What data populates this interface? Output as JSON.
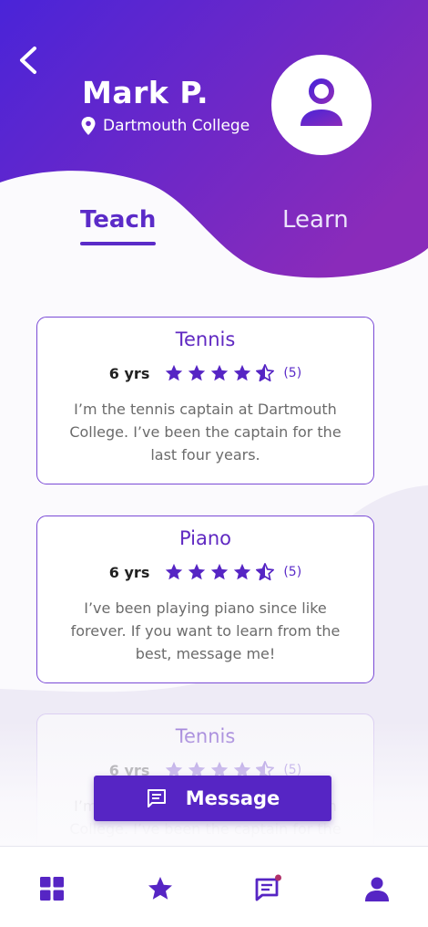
{
  "profile": {
    "name": "Mark P.",
    "location": "Dartmouth College"
  },
  "tabs": {
    "teach": "Teach",
    "learn": "Learn",
    "active": "Teach"
  },
  "skills": [
    {
      "title": "Tennis",
      "years": "6 yrs",
      "rating": 4.5,
      "reviews": "(5)",
      "description": "I’m the tennis captain at Dartmouth College. I’ve been the captain for the last four years."
    },
    {
      "title": "Piano",
      "years": "6 yrs",
      "rating": 4.5,
      "reviews": "(5)",
      "description": "I’ve been playing piano since like forever. If you want to learn from the best, message me!"
    },
    {
      "title": "Tennis",
      "years": "6 yrs",
      "rating": 4.5,
      "reviews": "(5)",
      "description": "I’m the tennis captain at Dartmouth College. I’ve been the captain for the last four years."
    }
  ],
  "message_button": {
    "label": "Message",
    "icon": "chat-icon"
  },
  "bottom_nav": {
    "items": [
      "grid-icon",
      "star-icon",
      "chat-icon",
      "profile-icon"
    ],
    "chat_has_notification": true
  },
  "colors": {
    "primary": "#5625c4",
    "gradient_start": "#4a24d8",
    "gradient_end": "#8a2bba",
    "notification_dot": "#b0306a"
  }
}
